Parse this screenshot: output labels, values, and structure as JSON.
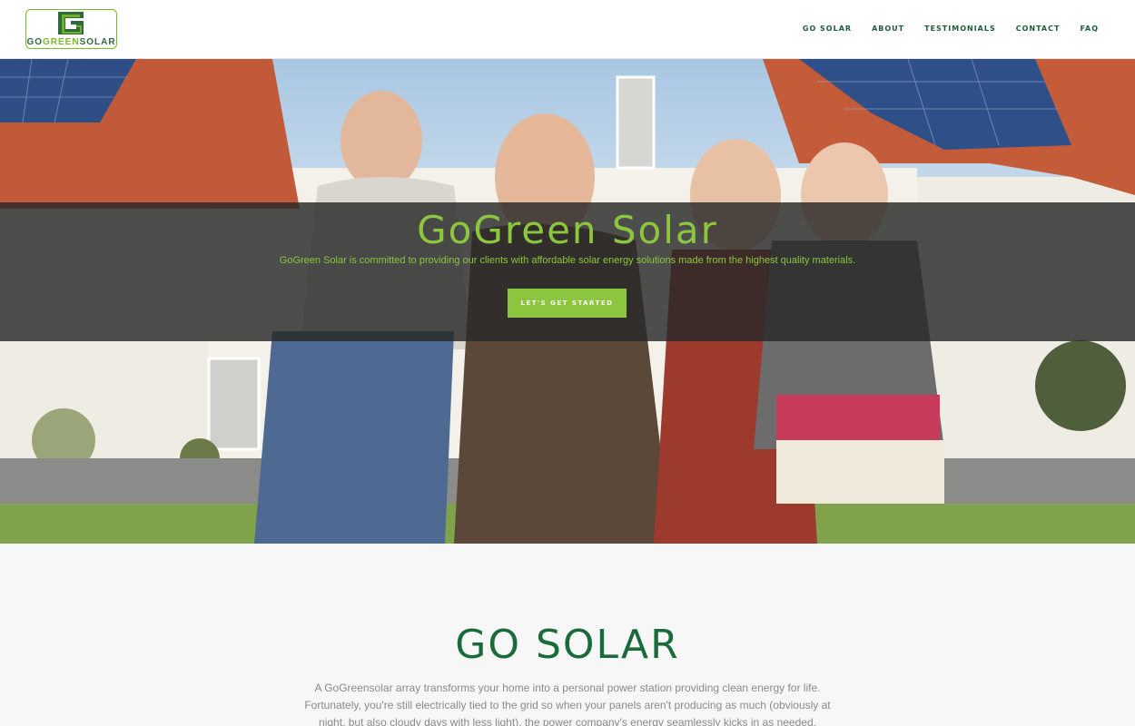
{
  "header": {
    "logo": {
      "go": "GO",
      "green": "GREEN",
      "solar": "SOLAR",
      "mark": "G"
    },
    "nav": [
      "GO SOLAR",
      "ABOUT",
      "TESTIMONIALS",
      "CONTACT",
      "FAQ"
    ]
  },
  "hero": {
    "title": "GoGreen Solar",
    "subtitle": "GoGreen Solar is committed to providing our clients with affordable solar energy solutions made from the highest quality materials.",
    "cta": "LET'S GET STARTED"
  },
  "section": {
    "title": "GO SOLAR",
    "body": "A GoGreensolar array transforms your home into a personal power station providing clean energy for life. Fortunately, you're still electrically tied to the grid so when your panels aren't producing as much (obviously at night, but also cloudy days with less light), the power company's energy seamlessly kicks in as needed."
  },
  "colors": {
    "brand_green": "#8cc63f",
    "dark_green": "#1a6b3a",
    "nav_green": "#1f5a3a",
    "band": "#282828"
  }
}
